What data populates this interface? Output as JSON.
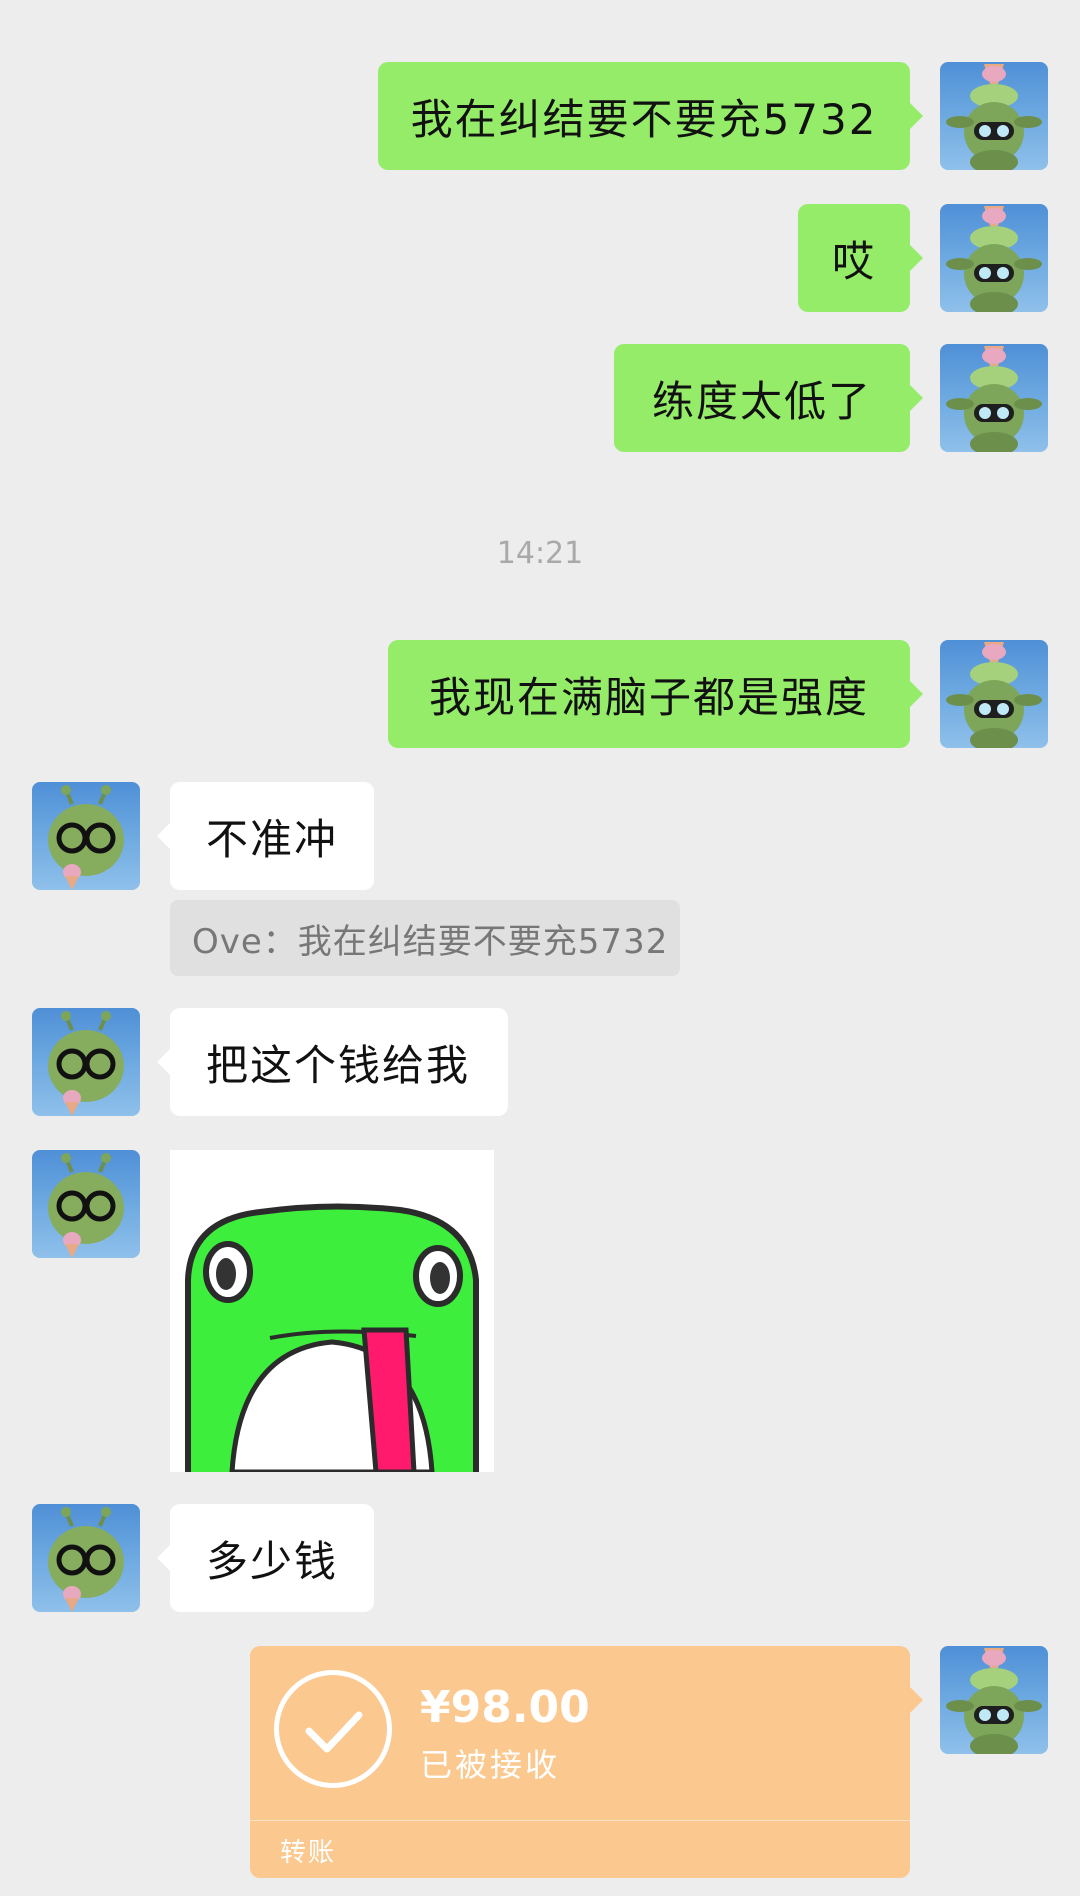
{
  "messages": {
    "m1": "我在纠结要不要充5732",
    "m2": "哎",
    "m3": "练度太低了",
    "m4": "我现在满脑子都是强度",
    "m5": "不准冲",
    "m6": "把这个钱给我",
    "m7": "多少钱"
  },
  "timestamp": "14:21",
  "quote": "Ove：我在纠结要不要充5732",
  "transfer": {
    "amount": "¥98.00",
    "status": "已被接收",
    "label": "转账"
  },
  "icons": {
    "my_avatar": "alien-with-ice-cream-hat-avatar",
    "their_avatar": "alien-with-glasses-avatar",
    "sticker": "green-frog-tongue-sticker",
    "check": "check-circle-icon"
  },
  "colors": {
    "background": "#ededed",
    "my_bubble": "#95ec69",
    "their_bubble": "#ffffff",
    "transfer": "#fbc990"
  }
}
